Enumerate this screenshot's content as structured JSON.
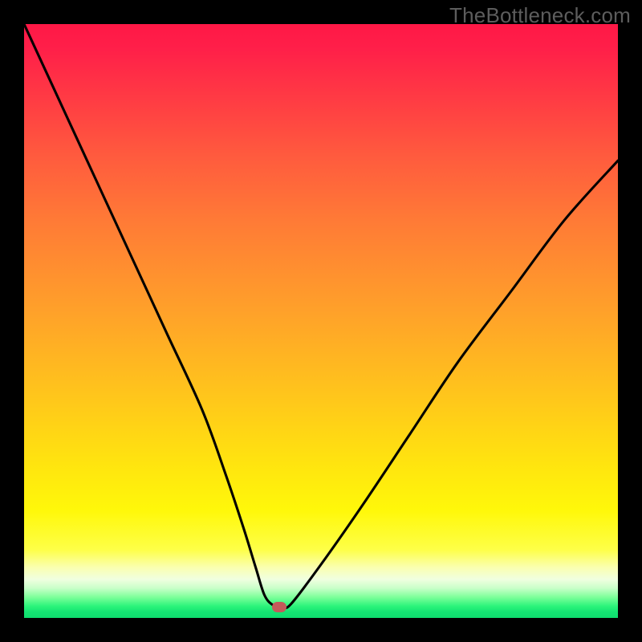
{
  "watermark": "TheBottleneck.com",
  "marker_color": "#c45a5a",
  "chart_data": {
    "type": "line",
    "title": "",
    "xlabel": "",
    "ylabel": "",
    "xlim": [
      0,
      100
    ],
    "ylim": [
      0,
      100
    ],
    "notes": "No axis ticks or labels rendered. Single V-shaped curve (bottleneck profile) on vertical rainbow gradient. Pill marker at curve minimum.",
    "series": [
      {
        "name": "bottleneck-curve",
        "x": [
          0,
          6,
          12,
          18,
          24,
          30,
          34,
          37,
          39,
          40.5,
          42,
          43.5,
          45,
          50,
          57,
          65,
          73,
          82,
          91,
          100
        ],
        "values": [
          100,
          87,
          74,
          61,
          48,
          35,
          24,
          15,
          8.5,
          3.8,
          2.1,
          1.8,
          2.4,
          9,
          19,
          31,
          43,
          55,
          67,
          77
        ],
        "color": "#000000"
      }
    ],
    "marker": {
      "name": "minimum-point",
      "x": 43,
      "y": 1.8,
      "color": "#c45a5a"
    }
  }
}
